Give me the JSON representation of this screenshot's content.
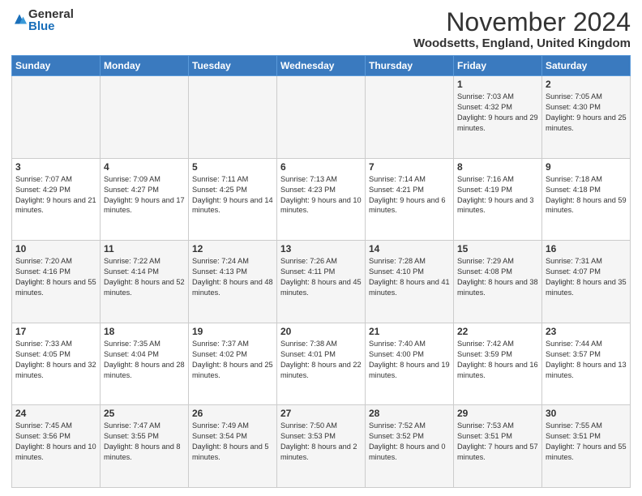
{
  "logo": {
    "general": "General",
    "blue": "Blue"
  },
  "header": {
    "month": "November 2024",
    "location": "Woodsetts, England, United Kingdom"
  },
  "weekdays": [
    "Sunday",
    "Monday",
    "Tuesday",
    "Wednesday",
    "Thursday",
    "Friday",
    "Saturday"
  ],
  "weeks": [
    [
      {
        "day": "",
        "info": ""
      },
      {
        "day": "",
        "info": ""
      },
      {
        "day": "",
        "info": ""
      },
      {
        "day": "",
        "info": ""
      },
      {
        "day": "",
        "info": ""
      },
      {
        "day": "1",
        "info": "Sunrise: 7:03 AM\nSunset: 4:32 PM\nDaylight: 9 hours and 29 minutes."
      },
      {
        "day": "2",
        "info": "Sunrise: 7:05 AM\nSunset: 4:30 PM\nDaylight: 9 hours and 25 minutes."
      }
    ],
    [
      {
        "day": "3",
        "info": "Sunrise: 7:07 AM\nSunset: 4:29 PM\nDaylight: 9 hours and 21 minutes."
      },
      {
        "day": "4",
        "info": "Sunrise: 7:09 AM\nSunset: 4:27 PM\nDaylight: 9 hours and 17 minutes."
      },
      {
        "day": "5",
        "info": "Sunrise: 7:11 AM\nSunset: 4:25 PM\nDaylight: 9 hours and 14 minutes."
      },
      {
        "day": "6",
        "info": "Sunrise: 7:13 AM\nSunset: 4:23 PM\nDaylight: 9 hours and 10 minutes."
      },
      {
        "day": "7",
        "info": "Sunrise: 7:14 AM\nSunset: 4:21 PM\nDaylight: 9 hours and 6 minutes."
      },
      {
        "day": "8",
        "info": "Sunrise: 7:16 AM\nSunset: 4:19 PM\nDaylight: 9 hours and 3 minutes."
      },
      {
        "day": "9",
        "info": "Sunrise: 7:18 AM\nSunset: 4:18 PM\nDaylight: 8 hours and 59 minutes."
      }
    ],
    [
      {
        "day": "10",
        "info": "Sunrise: 7:20 AM\nSunset: 4:16 PM\nDaylight: 8 hours and 55 minutes."
      },
      {
        "day": "11",
        "info": "Sunrise: 7:22 AM\nSunset: 4:14 PM\nDaylight: 8 hours and 52 minutes."
      },
      {
        "day": "12",
        "info": "Sunrise: 7:24 AM\nSunset: 4:13 PM\nDaylight: 8 hours and 48 minutes."
      },
      {
        "day": "13",
        "info": "Sunrise: 7:26 AM\nSunset: 4:11 PM\nDaylight: 8 hours and 45 minutes."
      },
      {
        "day": "14",
        "info": "Sunrise: 7:28 AM\nSunset: 4:10 PM\nDaylight: 8 hours and 41 minutes."
      },
      {
        "day": "15",
        "info": "Sunrise: 7:29 AM\nSunset: 4:08 PM\nDaylight: 8 hours and 38 minutes."
      },
      {
        "day": "16",
        "info": "Sunrise: 7:31 AM\nSunset: 4:07 PM\nDaylight: 8 hours and 35 minutes."
      }
    ],
    [
      {
        "day": "17",
        "info": "Sunrise: 7:33 AM\nSunset: 4:05 PM\nDaylight: 8 hours and 32 minutes."
      },
      {
        "day": "18",
        "info": "Sunrise: 7:35 AM\nSunset: 4:04 PM\nDaylight: 8 hours and 28 minutes."
      },
      {
        "day": "19",
        "info": "Sunrise: 7:37 AM\nSunset: 4:02 PM\nDaylight: 8 hours and 25 minutes."
      },
      {
        "day": "20",
        "info": "Sunrise: 7:38 AM\nSunset: 4:01 PM\nDaylight: 8 hours and 22 minutes."
      },
      {
        "day": "21",
        "info": "Sunrise: 7:40 AM\nSunset: 4:00 PM\nDaylight: 8 hours and 19 minutes."
      },
      {
        "day": "22",
        "info": "Sunrise: 7:42 AM\nSunset: 3:59 PM\nDaylight: 8 hours and 16 minutes."
      },
      {
        "day": "23",
        "info": "Sunrise: 7:44 AM\nSunset: 3:57 PM\nDaylight: 8 hours and 13 minutes."
      }
    ],
    [
      {
        "day": "24",
        "info": "Sunrise: 7:45 AM\nSunset: 3:56 PM\nDaylight: 8 hours and 10 minutes."
      },
      {
        "day": "25",
        "info": "Sunrise: 7:47 AM\nSunset: 3:55 PM\nDaylight: 8 hours and 8 minutes."
      },
      {
        "day": "26",
        "info": "Sunrise: 7:49 AM\nSunset: 3:54 PM\nDaylight: 8 hours and 5 minutes."
      },
      {
        "day": "27",
        "info": "Sunrise: 7:50 AM\nSunset: 3:53 PM\nDaylight: 8 hours and 2 minutes."
      },
      {
        "day": "28",
        "info": "Sunrise: 7:52 AM\nSunset: 3:52 PM\nDaylight: 8 hours and 0 minutes."
      },
      {
        "day": "29",
        "info": "Sunrise: 7:53 AM\nSunset: 3:51 PM\nDaylight: 7 hours and 57 minutes."
      },
      {
        "day": "30",
        "info": "Sunrise: 7:55 AM\nSunset: 3:51 PM\nDaylight: 7 hours and 55 minutes."
      }
    ]
  ]
}
